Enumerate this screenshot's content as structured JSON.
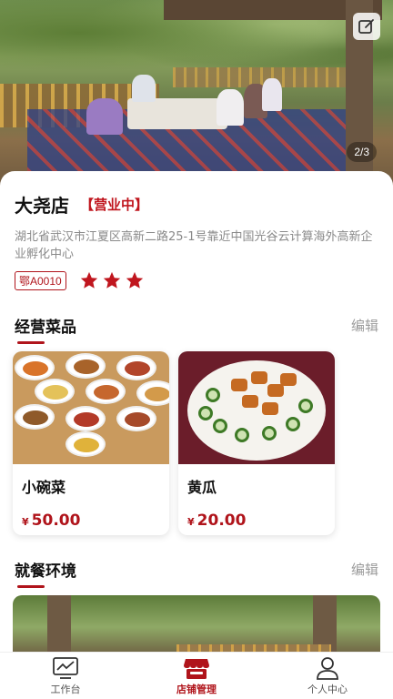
{
  "hero": {
    "pager": "2/3",
    "edit_icon": "edit-square-icon"
  },
  "store": {
    "name": "大尧店",
    "status": "【营业中】",
    "address": "湖北省武汉市江夏区高新二路25-1号靠近中国光谷云计算海外高新企业孵化中心",
    "plate": "鄂A0010",
    "rating": 3,
    "rating_max": 3
  },
  "dishes_section": {
    "title": "经营菜品",
    "edit_label": "编辑",
    "items": [
      {
        "name": "小碗菜",
        "currency": "¥",
        "price": "50.00"
      },
      {
        "name": "黄瓜",
        "currency": "¥",
        "price": "20.00"
      }
    ]
  },
  "env_section": {
    "title": "就餐环境",
    "edit_label": "编辑"
  },
  "tabbar": {
    "items": [
      {
        "label": "工作台",
        "icon": "chart-monitor-icon",
        "active": false
      },
      {
        "label": "店铺管理",
        "icon": "store-icon",
        "active": true
      },
      {
        "label": "个人中心",
        "icon": "user-icon",
        "active": false
      }
    ]
  },
  "colors": {
    "accent": "#b0141b",
    "muted": "#9b9b9b"
  }
}
